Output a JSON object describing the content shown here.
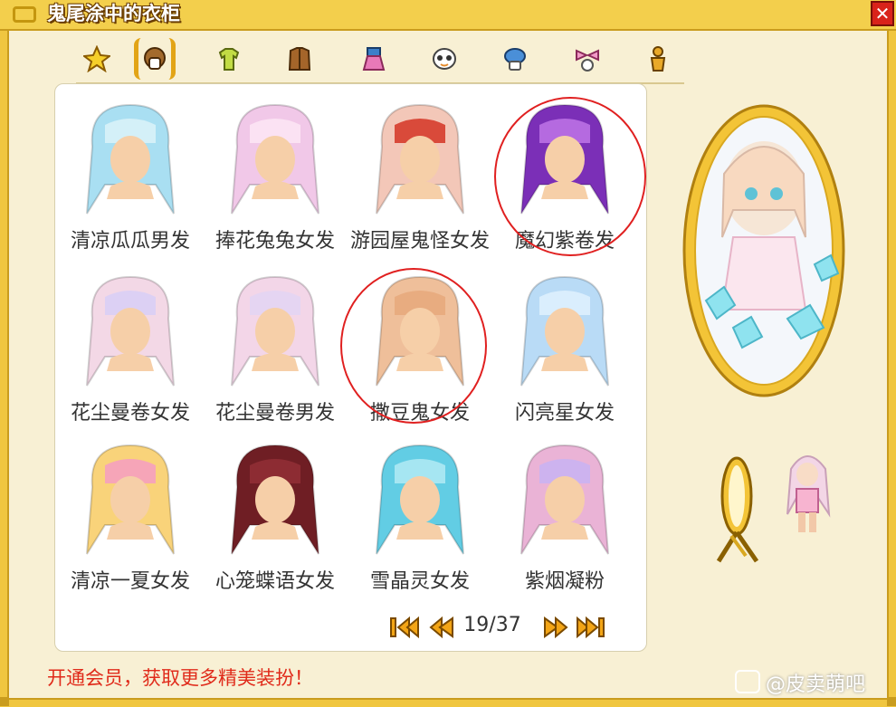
{
  "window": {
    "title": "鬼尾涂中的衣柜",
    "close_label": "✕"
  },
  "tabs": [
    {
      "icon": "star-icon"
    },
    {
      "icon": "hair-icon",
      "selected": true
    },
    {
      "icon": "shirt-icon"
    },
    {
      "icon": "coat-icon"
    },
    {
      "icon": "skirt-icon"
    },
    {
      "icon": "face-icon"
    },
    {
      "icon": "hat-icon"
    },
    {
      "icon": "bow-icon"
    },
    {
      "icon": "figure-icon"
    }
  ],
  "items": [
    {
      "label": "清凉瓜瓜男发",
      "color": "#a9dff2",
      "accent": "#d4f0f8"
    },
    {
      "label": "捧花兔兔女发",
      "color": "#f1c8e8",
      "accent": "#fbe2f3"
    },
    {
      "label": "游园屋鬼怪女发",
      "color": "#f3c7b8",
      "accent": "#d94a3a"
    },
    {
      "label": "魔幻紫卷发",
      "color": "#7b2fb7",
      "accent": "#b56ae0"
    },
    {
      "label": "花尘曼卷女发",
      "color": "#f3d8e6",
      "accent": "#dcd0f4"
    },
    {
      "label": "花尘曼卷男发",
      "color": "#f3d6e8",
      "accent": "#e5d5f2"
    },
    {
      "label": "撒豆鬼女发",
      "color": "#efbf9a",
      "accent": "#e8ac80"
    },
    {
      "label": "闪亮星女发",
      "color": "#b9dbf6",
      "accent": "#daeefd"
    },
    {
      "label": "清凉一夏女发",
      "color": "#f9d37a",
      "accent": "#f6a5b8"
    },
    {
      "label": "心笼蝶语女发",
      "color": "#6f1e24",
      "accent": "#8d2c33"
    },
    {
      "label": "雪晶灵女发",
      "color": "#62cde4",
      "accent": "#a6e6f2"
    },
    {
      "label": "紫烟凝粉",
      "color": "#eab3d6",
      "accent": "#cdb3ef"
    }
  ],
  "pager": {
    "text": "19/37"
  },
  "promo": "开通会员，获取更多精美装扮！",
  "watermark": "@皮卖萌吧",
  "colors": {
    "frame": "#f0c640",
    "highlight": "#e02020",
    "promo": "#e02a1a"
  }
}
